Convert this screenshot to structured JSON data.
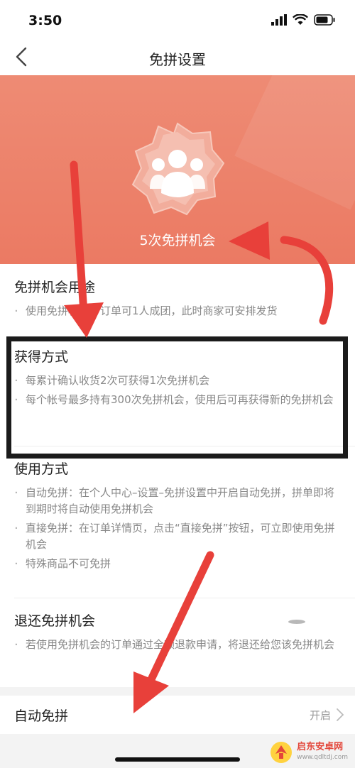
{
  "status_bar": {
    "time": "3:50"
  },
  "nav": {
    "title": "免拼设置"
  },
  "hero": {
    "count_text": "5次免拼机会"
  },
  "sections": {
    "usage": {
      "title": "免拼机会用途",
      "items": [
        "使用免拼机会，订单可1人成团，此时商家可安排发货"
      ]
    },
    "obtain": {
      "title": "获得方式",
      "items": [
        "每累计确认收货2次可获得1次免拼机会",
        "每个帐号最多持有300次免拼机会，使用后可再获得新的免拼机会"
      ]
    },
    "method": {
      "title": "使用方式",
      "items": [
        "自动免拼：在个人中心–设置–免拼设置中开启自动免拼，拼单即将到期时将自动使用免拼机会",
        "直接免拼：在订单详情页，点击“直接免拼”按钮，可立即使用免拼机会",
        "特殊商品不可免拼"
      ]
    },
    "refund": {
      "title": "退还免拼机会",
      "items": [
        "若使用免拼机会的订单通过全额退款申请，将退还给您该免拼机会"
      ]
    }
  },
  "auto_row": {
    "label": "自动免拼",
    "value": "开启"
  },
  "watermark": {
    "name": "启东安卓网",
    "url": "www.qdltdj.com"
  },
  "colors": {
    "hero": "#ec7f68",
    "annotation_red": "#e8403a",
    "annotation_box": "#1b1b1b"
  }
}
